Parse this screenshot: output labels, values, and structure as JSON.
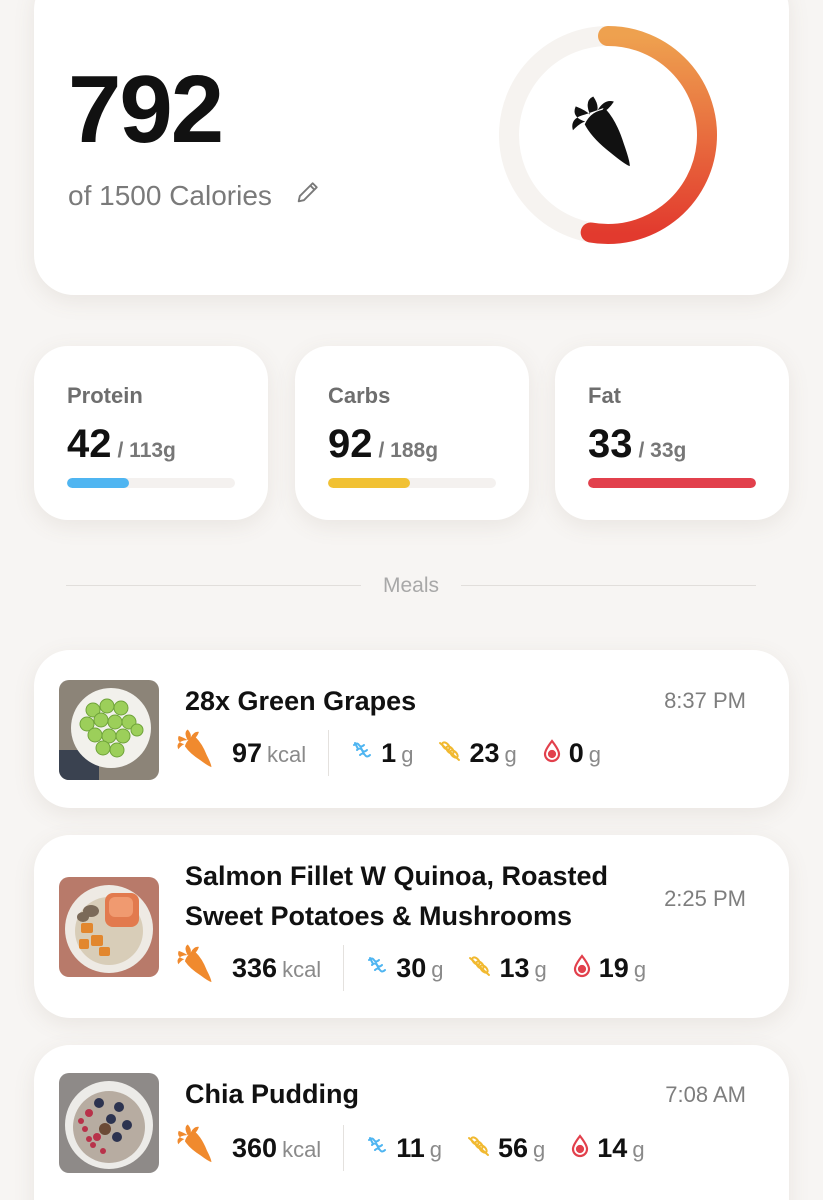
{
  "summary": {
    "calories": "792",
    "goal_text": "of 1500 Calories",
    "progress_fraction": 0.528,
    "icons": {
      "edit": "pencil-icon",
      "center": "carrot-icon"
    }
  },
  "macros": [
    {
      "label": "Protein",
      "value": "42",
      "goal": "/ 113g",
      "fraction": 0.37,
      "color": "#4fb5f1"
    },
    {
      "label": "Carbs",
      "value": "92",
      "goal": "/ 188g",
      "fraction": 0.49,
      "color": "#f1c133"
    },
    {
      "label": "Fat",
      "value": "33",
      "goal": "/ 33g",
      "fraction": 1.0,
      "color": "#e2404c"
    }
  ],
  "meals_label": "Meals",
  "meals": [
    {
      "name": "28x Green Grapes",
      "time": "8:37 PM",
      "kcal": "97",
      "kcal_unit": "kcal",
      "protein": "1",
      "carbs": "23",
      "fat": "0",
      "unit": "g"
    },
    {
      "name": "Salmon Fillet W Quinoa, Roasted Sweet Potatoes & Mushrooms",
      "time": "2:25 PM",
      "kcal": "336",
      "kcal_unit": "kcal",
      "protein": "30",
      "carbs": "13",
      "fat": "19",
      "unit": "g"
    },
    {
      "name": "Chia Pudding",
      "time": "7:08 AM",
      "kcal": "360",
      "kcal_unit": "kcal",
      "protein": "11",
      "carbs": "56",
      "fat": "14",
      "unit": "g"
    }
  ],
  "colors": {
    "ring_start": "#eea14f",
    "ring_end": "#e23a2e",
    "carrot_orange": "#f08a2e",
    "protein_icon": "#4fb5f1",
    "carbs_icon": "#f1b930",
    "fat_icon": "#e2404c"
  }
}
